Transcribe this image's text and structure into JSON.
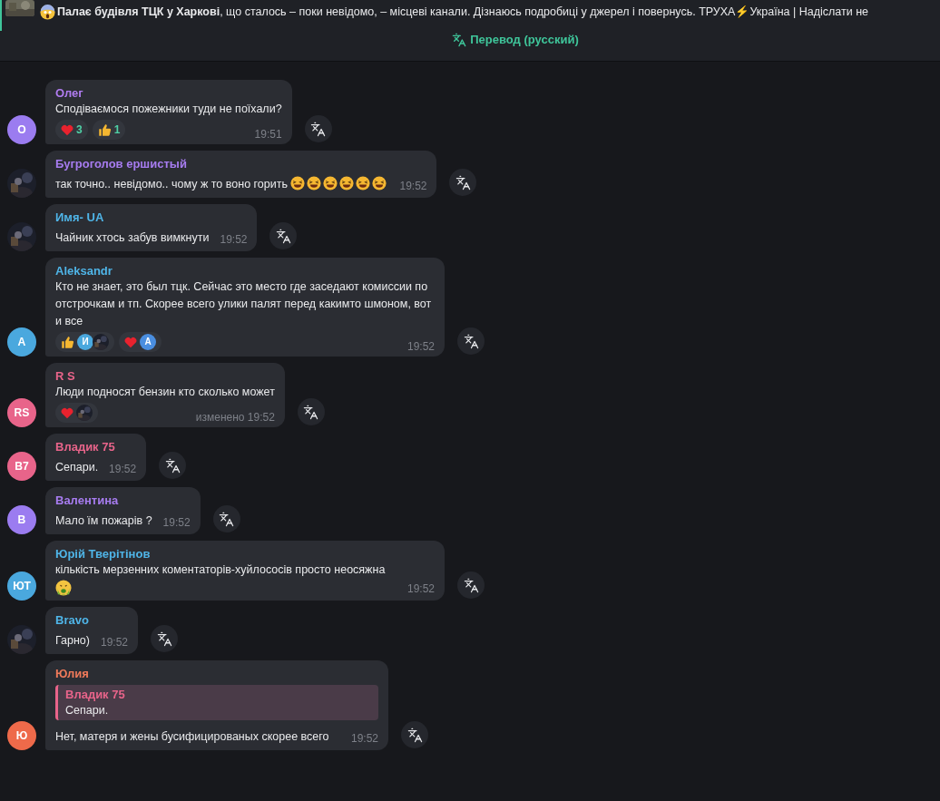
{
  "pinned": {
    "text": "**Палає будівля ТЦК у Харкові**,  що сталось – поки невідомо, – місцеві канали.  Дізнаюсь подробиці у джерел і повернусь.  ТРУХА⚡Україна | Надіслати не",
    "emoji": {
      "kind": "scream"
    },
    "translate_button": "Перевод (русский)"
  },
  "messages": [
    {
      "author": "Олег",
      "color": "#b07cf0",
      "avatar": {
        "kind": "initials",
        "text": "О",
        "color": "#9b7cf0"
      },
      "text": "Сподіваємося пожежники туди не поїхали?",
      "reactions": [
        {
          "kind": "heart",
          "count": "3"
        },
        {
          "kind": "thumbs",
          "count": "1"
        }
      ],
      "time": "19:51"
    },
    {
      "author": "Бугроголов ершистый",
      "color": "#a77cf0",
      "avatar": {
        "kind": "picture"
      },
      "text": "так точно.. невідомо.. чому ж то воно горить",
      "emojis": [
        {
          "kind": "laughing"
        },
        {
          "kind": "laughing"
        },
        {
          "kind": "laughing"
        },
        {
          "kind": "laughing"
        },
        {
          "kind": "laughing"
        },
        {
          "kind": "laughing"
        }
      ],
      "time": "19:52"
    },
    {
      "author": "Имя- UA",
      "color": "#4fb5e8",
      "avatar": {
        "kind": "picture"
      },
      "text": "Чайник хтось забув вимкнути",
      "time": "19:52"
    },
    {
      "author": "Aleksandr",
      "color": "#4fb5e8",
      "avatar": {
        "kind": "initials",
        "text": "A",
        "color": "#4aa8de"
      },
      "text": "Кто не знает, это был тцк. Сейчас это место где заседают комиссии по отстрочкам и тп. Скорее всего улики палят перед какимто шмоном, вот и все",
      "reactions": [
        {
          "kind": "thumbs",
          "reactors": [
            {
              "kind": "initials",
              "text": "И",
              "color": "#4aa8de"
            },
            {
              "kind": "picture"
            }
          ]
        },
        {
          "kind": "heart",
          "reactors": [
            {
              "kind": "initials",
              "text": "A",
              "color": "#4a8ee0"
            }
          ]
        }
      ],
      "time": "19:52"
    },
    {
      "author": "R S",
      "color": "#e8648a",
      "avatar": {
        "kind": "initials",
        "text": "RS",
        "color": "#e8648a"
      },
      "text": "Люди подносят бензин кто сколько может",
      "reactions": [
        {
          "kind": "heart",
          "reactors": [
            {
              "kind": "picture"
            }
          ]
        }
      ],
      "edited": "изменено",
      "time": "19:52"
    },
    {
      "author": "Владик 75",
      "color": "#e8648a",
      "avatar": {
        "kind": "initials",
        "text": "В7",
        "color": "#e8648a"
      },
      "text": "Сепари.",
      "time": "19:52"
    },
    {
      "author": "Валентина",
      "color": "#a77cf0",
      "avatar": {
        "kind": "initials",
        "text": "В",
        "color": "#9b7cf0"
      },
      "text": "Мало їм пожарів ?",
      "time": "19:52"
    },
    {
      "author": "Юрій Тверітінов",
      "color": "#4fb5e8",
      "avatar": {
        "kind": "initials",
        "text": "ЮТ",
        "color": "#4aa8de"
      },
      "text": "кількість мерзенних коментаторів-хуйлососів просто неосяжна",
      "emojis": [
        {
          "kind": "nauseated"
        }
      ],
      "time": "19:52"
    },
    {
      "author": "Bravo",
      "color": "#4fb5e8",
      "avatar": {
        "kind": "picture"
      },
      "text": "Гарно)",
      "time": "19:52"
    },
    {
      "author": "Юлия",
      "color": "#f07a5a",
      "avatar": {
        "kind": "initials",
        "text": "Ю",
        "color": "#ee6a4a"
      },
      "reply": {
        "author": "Владик 75",
        "text": "Сепари.",
        "color": "#e8648a"
      },
      "text": "Нет, матеря и жены бусифицированых скорее всего",
      "time": "19:52"
    }
  ]
}
